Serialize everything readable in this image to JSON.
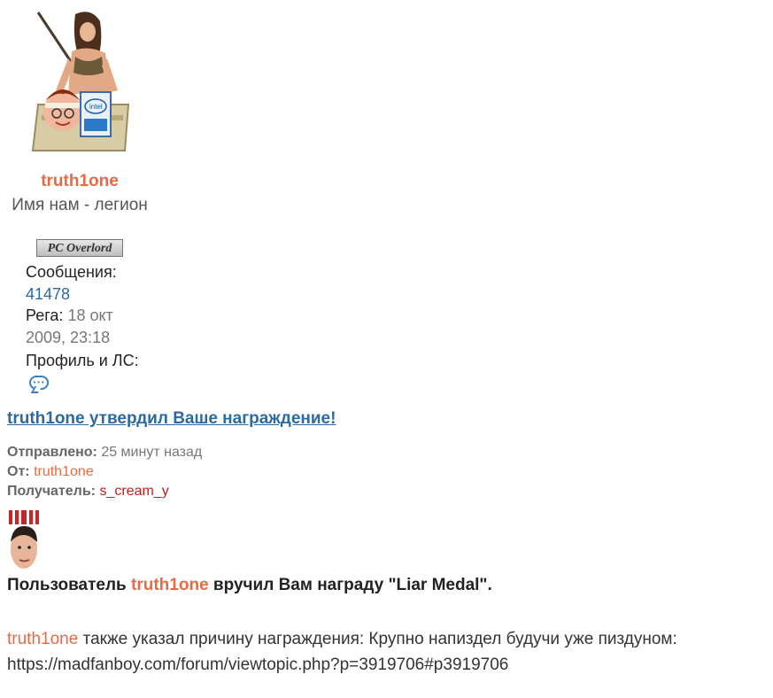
{
  "profile": {
    "username": "truth1one",
    "rank_title": "Имя нам - легион",
    "rank_badge": "PC Overlord",
    "posts_label": "Сообщения:",
    "posts_value": "41478",
    "reg_label": "Рега:",
    "reg_value": "18 окт 2009, 23:18",
    "contact_label": "Профиль и ЛС:",
    "contact_icon": "chat-bubble-icon"
  },
  "message": {
    "title": "truth1one утвердил Ваше награждение!",
    "sent_label": "Отправлено:",
    "sent_value": "25 минут назад",
    "from_label": "От:",
    "from_value": "truth1one",
    "to_label": "Получатель:",
    "to_value": "s_cream_y",
    "body_prefix": "Пользователь ",
    "body_user": "truth1one",
    "body_suffix": " вручил Вам награду \"Liar Medal\".",
    "reason_user": "truth1one",
    "reason_text": " также указал причину награждения: Крупно напиздел будучи уже пиздуном: https://madfanboy.com/forum/viewtopic.php?p=3919706#p3919706"
  },
  "colors": {
    "username": "#e86a45",
    "link": "#2d6aa0",
    "recipient": "#c21d1d"
  }
}
